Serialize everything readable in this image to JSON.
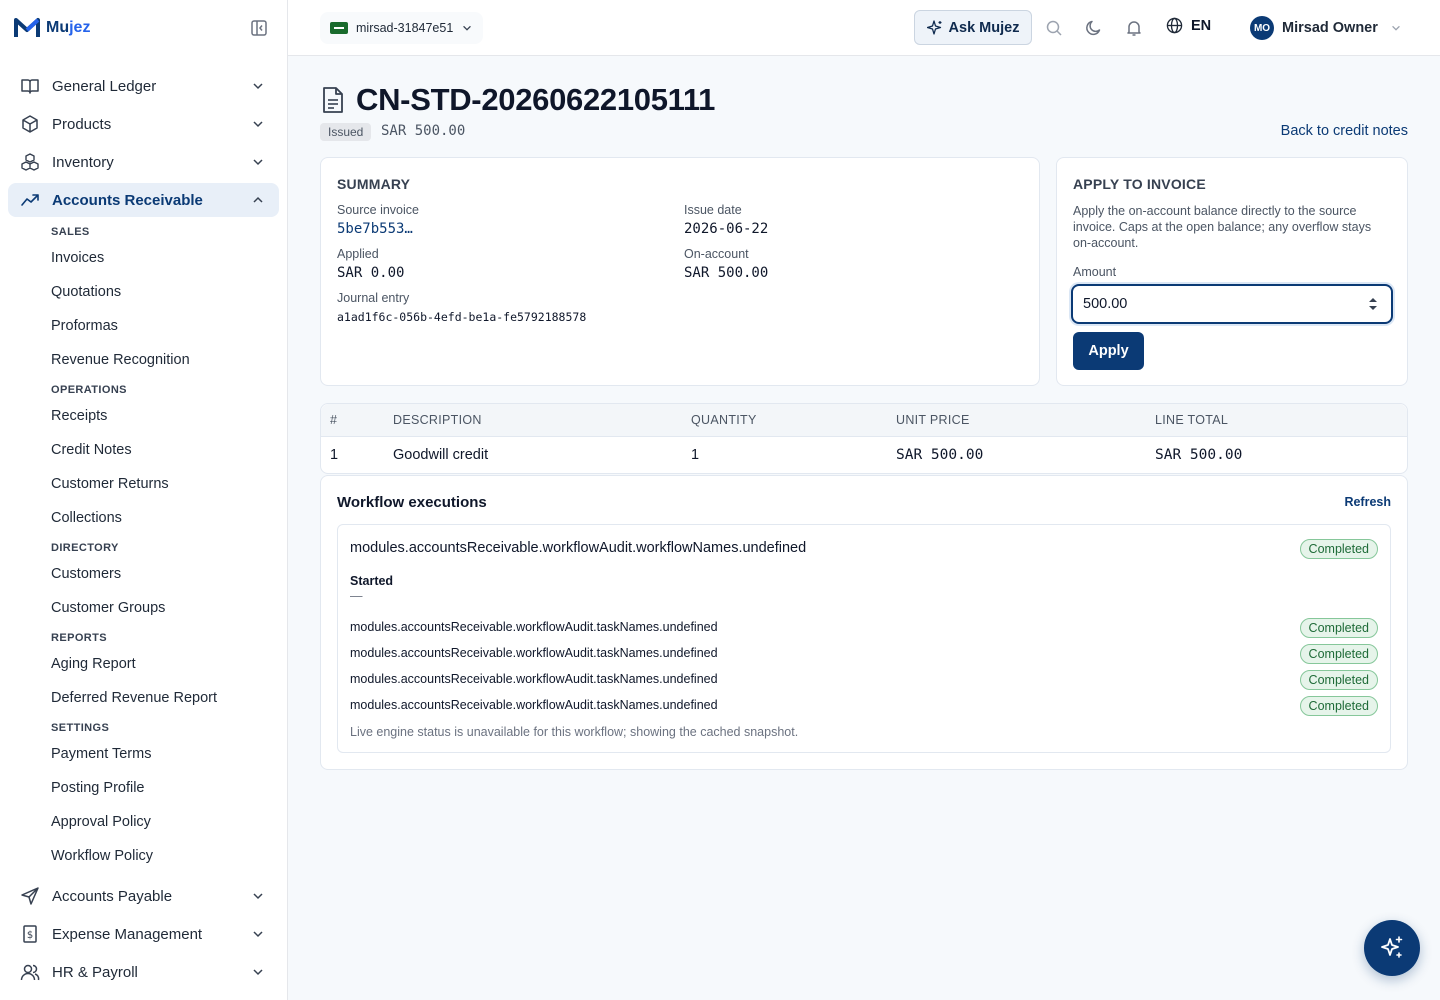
{
  "brand": {
    "name_a": "Mu",
    "name_b": "jez"
  },
  "sidebar": {
    "top_items": [
      {
        "label": "General Ledger"
      },
      {
        "label": "Products"
      },
      {
        "label": "Inventory"
      },
      {
        "label": "Accounts Receivable"
      }
    ],
    "sections": {
      "sales": "SALES",
      "operations": "OPERATIONS",
      "directory": "DIRECTORY",
      "reports": "REPORTS",
      "settings": "SETTINGS"
    },
    "sub_items": [
      "Invoices",
      "Quotations",
      "Proformas",
      "Revenue Recognition",
      "Receipts",
      "Credit Notes",
      "Customer Returns",
      "Collections",
      "Customers",
      "Customer Groups",
      "Aging Report",
      "Deferred Revenue Report",
      "Payment Terms",
      "Posting Profile",
      "Approval Policy",
      "Workflow Policy"
    ],
    "bottom_items": [
      {
        "label": "Accounts Payable"
      },
      {
        "label": "Expense Management"
      },
      {
        "label": "HR & Payroll"
      }
    ]
  },
  "topbar": {
    "org": "mirsad-31847e51",
    "ask": "Ask Mujez",
    "lang": "EN",
    "user_initials": "MO",
    "user_name": "Mirsad Owner"
  },
  "page": {
    "title": "CN-STD-20260622105111",
    "status": "Issued",
    "amount": "SAR 500.00",
    "back": "Back to credit notes"
  },
  "summary": {
    "title": "SUMMARY",
    "source_invoice_label": "Source invoice",
    "source_invoice": "5be7b553…",
    "issue_date_label": "Issue date",
    "issue_date": "2026-06-22",
    "applied_label": "Applied",
    "applied": "SAR 0.00",
    "on_account_label": "On-account",
    "on_account": "SAR 500.00",
    "journal_label": "Journal entry",
    "journal": "a1ad1f6c-056b-4efd-be1a-fe5792188578"
  },
  "apply": {
    "title": "APPLY TO INVOICE",
    "description": "Apply the on-account balance directly to the source invoice. Caps at the open balance; any overflow stays on-account.",
    "amount_label": "Amount",
    "amount_value": "500.00",
    "button": "Apply"
  },
  "lines": {
    "headers": [
      "#",
      "DESCRIPTION",
      "QUANTITY",
      "UNIT PRICE",
      "LINE TOTAL"
    ],
    "rows": [
      {
        "num": "1",
        "description": "Goodwill credit",
        "quantity": "1",
        "unit_price": "SAR 500.00",
        "line_total": "SAR 500.00"
      }
    ]
  },
  "workflow": {
    "title": "Workflow executions",
    "refresh": "Refresh",
    "name": "modules.accountsReceivable.workflowAudit.workflowNames.undefined",
    "status": "Completed",
    "started_label": "Started",
    "started_value": "—",
    "tasks": [
      {
        "name": "modules.accountsReceivable.workflowAudit.taskNames.undefined",
        "status": "Completed"
      },
      {
        "name": "modules.accountsReceivable.workflowAudit.taskNames.undefined",
        "status": "Completed"
      },
      {
        "name": "modules.accountsReceivable.workflowAudit.taskNames.undefined",
        "status": "Completed"
      },
      {
        "name": "modules.accountsReceivable.workflowAudit.taskNames.undefined",
        "status": "Completed"
      }
    ],
    "note": "Live engine status is unavailable for this workflow; showing the cached snapshot."
  },
  "icons": {
    "brand": "mujez-logo-icon",
    "collapse": "sidebar-collapse-icon",
    "ask": "sparkle-icon",
    "search": "search-icon",
    "theme": "moon-icon",
    "notifications": "bell-icon",
    "language": "globe-icon",
    "document": "document-icon",
    "fab": "sparkle-icon"
  },
  "colors": {
    "primary": "#0b3a75",
    "success_bg": "#e6f4ea",
    "success_text": "#1f6b38"
  }
}
